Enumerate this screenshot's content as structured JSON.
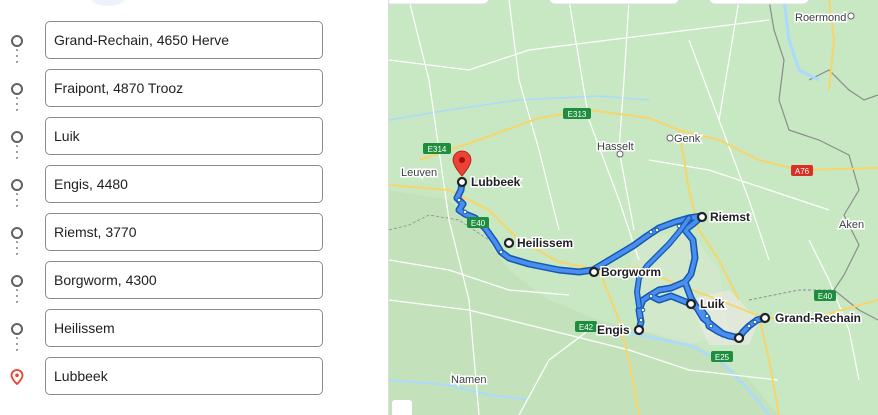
{
  "route": {
    "stops": [
      {
        "value": "Grand-Rechain, 4650 Herve",
        "kind": "waypoint"
      },
      {
        "value": "Fraipont, 4870 Trooz",
        "kind": "waypoint"
      },
      {
        "value": "Luik",
        "kind": "waypoint"
      },
      {
        "value": "Engis, 4480",
        "kind": "waypoint"
      },
      {
        "value": "Riemst, 3770",
        "kind": "waypoint"
      },
      {
        "value": "Borgworm, 4300",
        "kind": "waypoint"
      },
      {
        "value": "Heilissem",
        "kind": "waypoint"
      },
      {
        "value": "Lubbeek",
        "kind": "destination"
      }
    ]
  },
  "map": {
    "colors": {
      "land": "#c7e6c4",
      "water": "#aadaff",
      "route": "#1a73e8",
      "route_outline": "#1558b0",
      "pin": "#ea4335"
    },
    "places": {
      "roermond": "Roermond",
      "genk": "Genk",
      "hasselt": "Hasselt",
      "leuven": "Leuven",
      "aken": "Aken",
      "namen": "Namen"
    },
    "road_shields": {
      "e313": "E313",
      "e314": "E314",
      "e40_west": "E40",
      "e42": "E42",
      "e25": "E25",
      "e40_east": "E40",
      "a76": "A76"
    },
    "waypoint_labels": {
      "lubbeek": "Lubbeek",
      "heilissem": "Heilissem",
      "borgworm": "Borgworm",
      "riemst": "Riemst",
      "luik": "Luik",
      "engis": "Engis",
      "grand_rechain": "Grand-Rechain"
    }
  }
}
